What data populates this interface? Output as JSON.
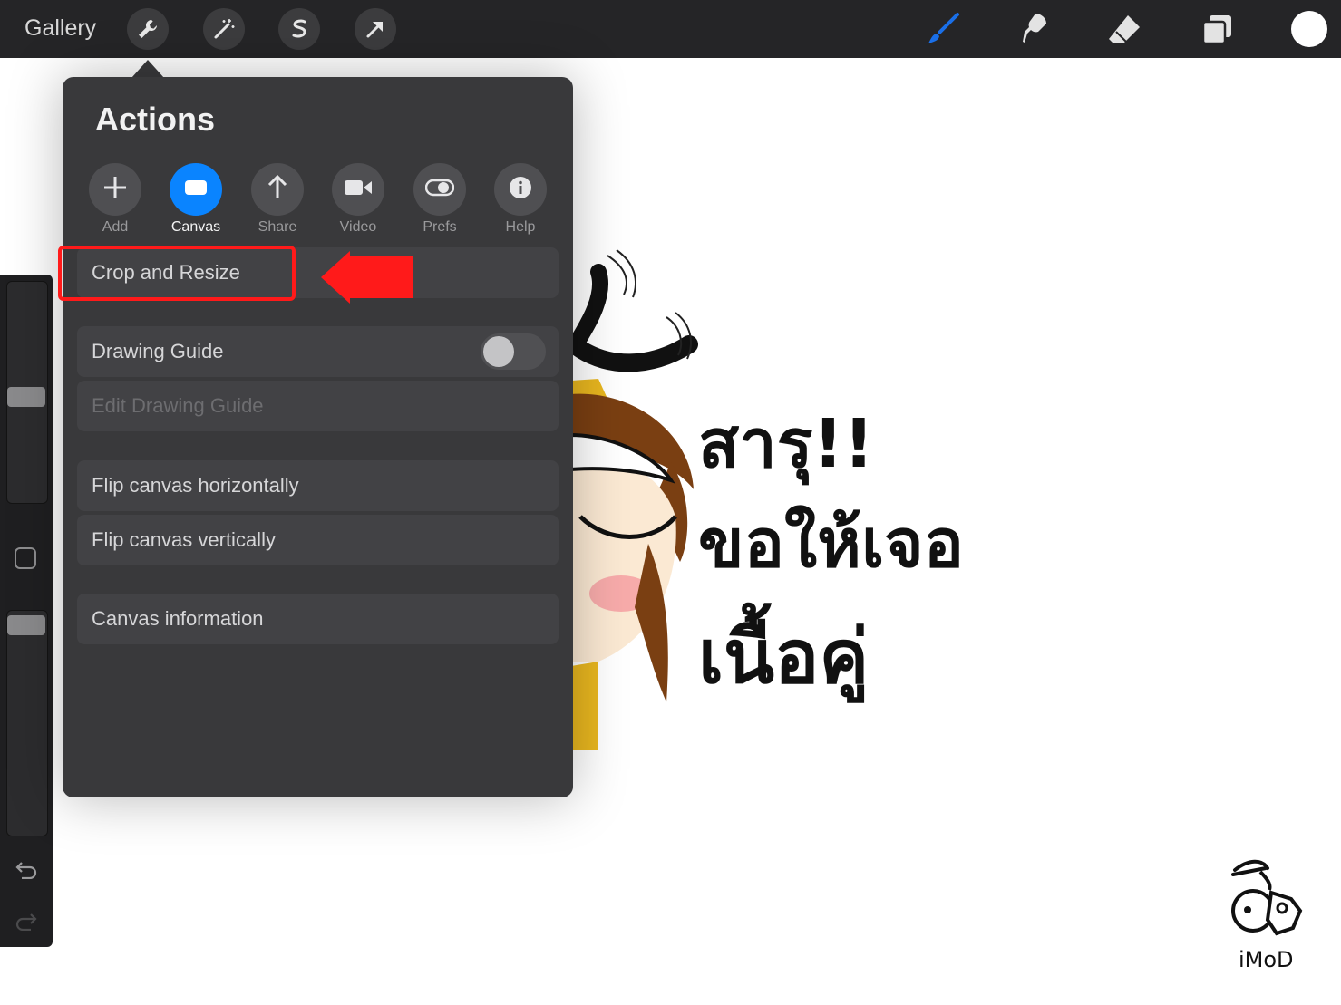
{
  "toolbar": {
    "gallery_label": "Gallery",
    "left_tools": [
      "actions-wrench-icon",
      "adjustments-wand-icon",
      "selection-s-icon",
      "transform-arrow-icon"
    ],
    "right_tools": [
      "brush-icon",
      "smudge-icon",
      "eraser-icon",
      "layers-icon"
    ],
    "brush_color": "#1a6fe8",
    "current_color": "#ffffff"
  },
  "artwork": {
    "line1": "สารุ!!",
    "line2": "ขอให้เจอ",
    "line3": "เนื้อคู่"
  },
  "actions_panel": {
    "title": "Actions",
    "tabs": [
      {
        "label": "Add",
        "icon": "plus-icon"
      },
      {
        "label": "Canvas",
        "icon": "canvas-icon",
        "active": true
      },
      {
        "label": "Share",
        "icon": "share-arrow-icon"
      },
      {
        "label": "Video",
        "icon": "video-camera-icon"
      },
      {
        "label": "Prefs",
        "icon": "toggle-icon"
      },
      {
        "label": "Help",
        "icon": "info-icon"
      }
    ],
    "items": {
      "crop_resize": "Crop and Resize",
      "drawing_guide": "Drawing Guide",
      "drawing_guide_on": false,
      "edit_drawing_guide": "Edit Drawing Guide",
      "flip_h": "Flip canvas horizontally",
      "flip_v": "Flip canvas vertically",
      "canvas_info": "Canvas information"
    },
    "accent": "#0a84ff"
  },
  "annotation": {
    "highlight_color": "#ff1a1a"
  },
  "watermark": {
    "text": "iMoD"
  }
}
